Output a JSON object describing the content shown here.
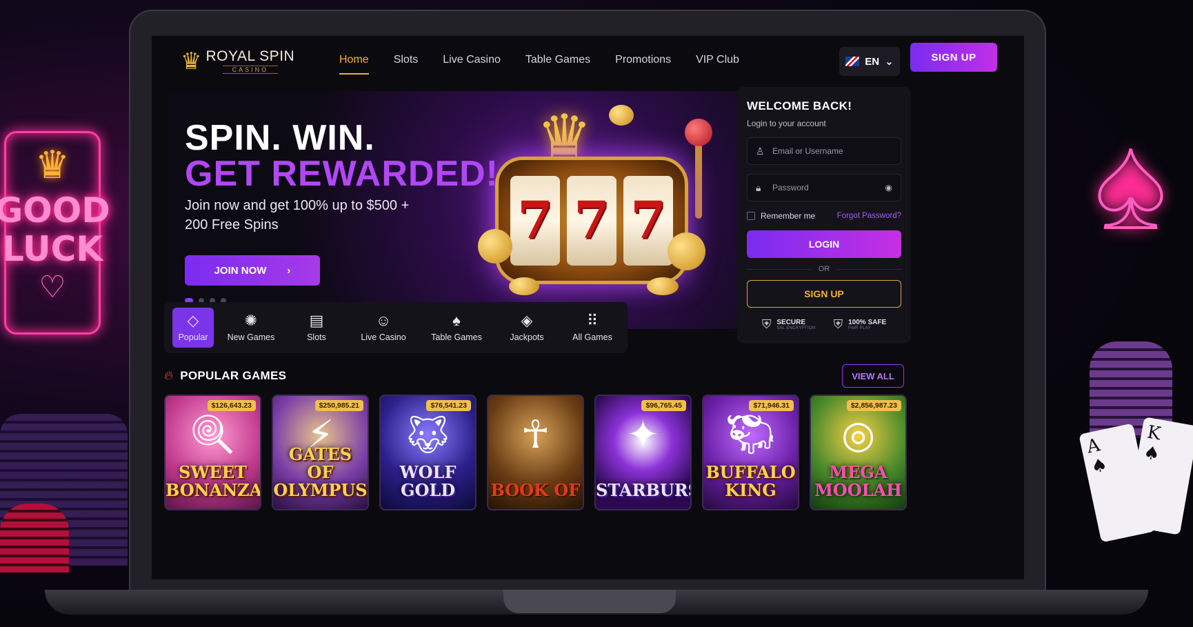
{
  "brand": {
    "name": "ROYAL SPIN",
    "sub": "CASINO"
  },
  "nav": {
    "links": [
      {
        "label": "Home",
        "active": true
      },
      {
        "label": "Slots",
        "active": false
      },
      {
        "label": "Live Casino",
        "active": false
      },
      {
        "label": "Table Games",
        "active": false
      },
      {
        "label": "Promotions",
        "active": false
      },
      {
        "label": "VIP Club",
        "active": false
      }
    ],
    "language": "EN",
    "signup": "SIGN UP"
  },
  "hero": {
    "title_line1": "SPIN. WIN.",
    "title_line2": "GET REWARDED!",
    "subtitle": "Join now and get 100% up to $500 + 200 Free Spins",
    "cta": "JOIN NOW",
    "slot_symbols": [
      "7",
      "7",
      "7"
    ],
    "slides": 4,
    "active_slide": 1
  },
  "categories": [
    {
      "label": "Popular",
      "icon": "diamond-icon",
      "active": true
    },
    {
      "label": "New Games",
      "icon": "new-badge-icon",
      "active": false
    },
    {
      "label": "Slots",
      "icon": "slot-machine-icon",
      "active": false
    },
    {
      "label": "Live Casino",
      "icon": "dealer-icon",
      "active": false
    },
    {
      "label": "Table Games",
      "icon": "cards-icon",
      "active": false
    },
    {
      "label": "Jackpots",
      "icon": "diamond-outline-icon",
      "active": false
    },
    {
      "label": "All Games",
      "icon": "grid-icon",
      "active": false
    }
  ],
  "login": {
    "title": "WELCOME BACK!",
    "subtitle": "Login to your account",
    "email_placeholder": "Email or Username",
    "password_placeholder": "Password",
    "remember": "Remember me",
    "forgot": "Forgot Password?",
    "login_button": "LOGIN",
    "or": "OR",
    "signup_button": "SIGN UP",
    "badges": [
      {
        "title": "SECURE",
        "sub": "SSL ENCRYPTION",
        "icon": "shield-lock-icon"
      },
      {
        "title": "100% SAFE",
        "sub": "FAIR PLAY",
        "icon": "shield-check-icon"
      }
    ]
  },
  "popular": {
    "title": "POPULAR GAMES",
    "view_all": "VIEW ALL",
    "games": [
      {
        "title": "SWEET BONANZA",
        "jackpot": "$126,643.23"
      },
      {
        "title": "GATES OF OLYMPUS",
        "jackpot": "$250,985.21"
      },
      {
        "title": "WOLF GOLD",
        "jackpot": "$76,541.23"
      },
      {
        "title": "BOOK OF",
        "jackpot": ""
      },
      {
        "title": "STARBURST",
        "jackpot": "$96,765.45"
      },
      {
        "title": "BUFFALO KING",
        "jackpot": "$71,946.31"
      },
      {
        "title": "MEGA MOOLAH",
        "jackpot": "$2,856,987.23"
      }
    ]
  },
  "background": {
    "neon_sign": "GOOD LUCK"
  },
  "colors": {
    "accent": "#7b34ea",
    "gold": "#f0b23a",
    "pink": "#c72fe3"
  }
}
